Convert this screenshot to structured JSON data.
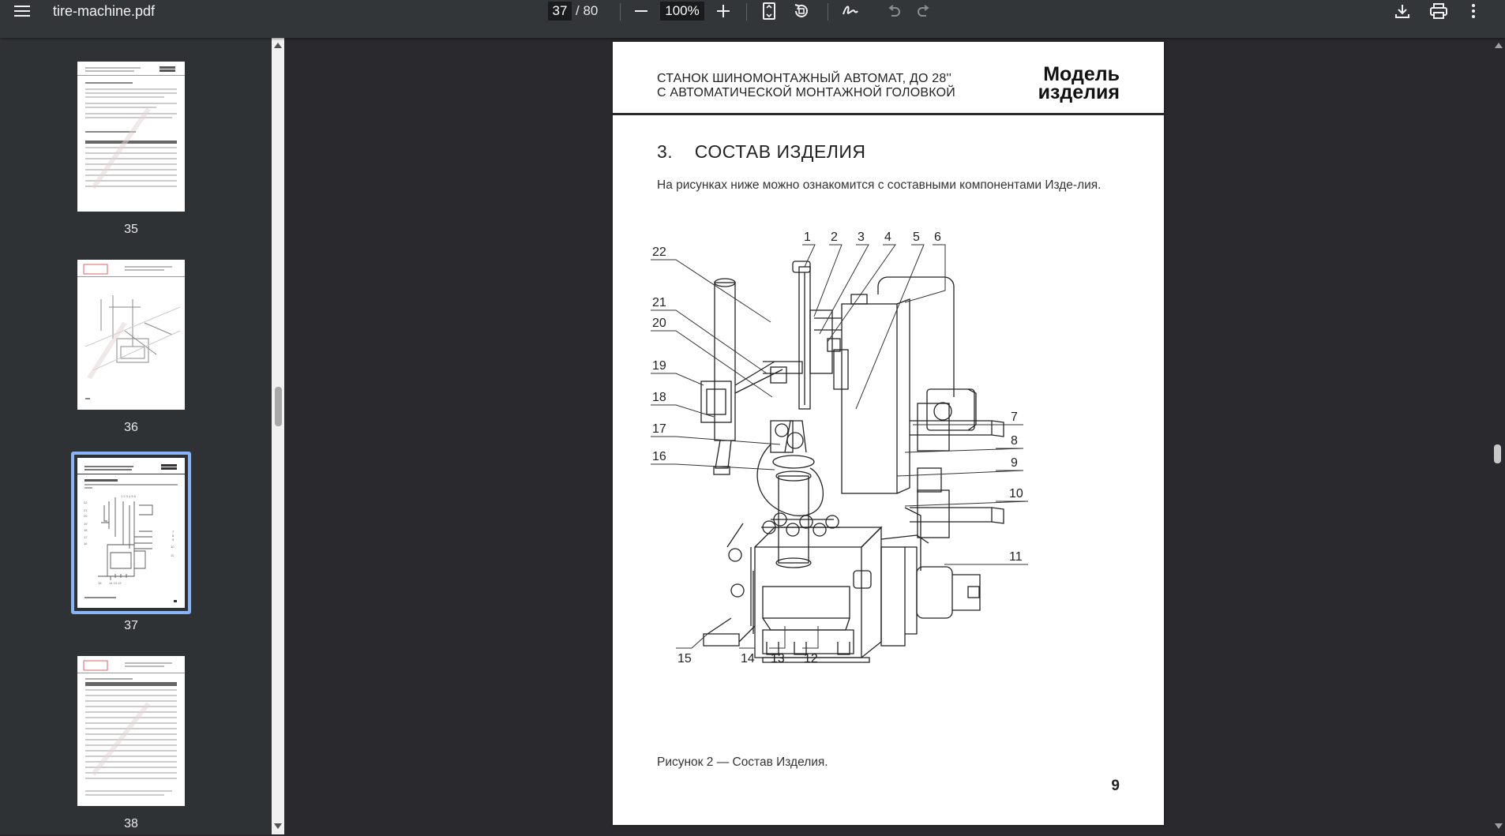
{
  "toolbar": {
    "file_name": "tire-machine.pdf",
    "current_page": "37",
    "total_pages": "/ 80",
    "zoom": "100%"
  },
  "sidebar": {
    "thumbnails": [
      {
        "label": "35"
      },
      {
        "label": "36"
      },
      {
        "label": "37",
        "selected": true
      },
      {
        "label": "38"
      }
    ]
  },
  "page": {
    "header_line1": "СТАНОК ШИНОМОНТАЖНЫЙ АВТОМАТ, ДО 28''",
    "header_line2": "С АВТОМАТИЧЕСКОЙ МОНТАЖНОЙ ГОЛОВКОЙ",
    "model_line1": "Модель",
    "model_line2": "изделия",
    "section_title": "3.    СОСТАВ ИЗДЕЛИЯ",
    "intro": "На рисунках ниже можно ознакомится с составными компонентами Изде-лия.",
    "callouts": [
      "1",
      "2",
      "3",
      "4",
      "5",
      "6",
      "7",
      "8",
      "9",
      "10",
      "11",
      "12",
      "13",
      "14",
      "15",
      "16",
      "17",
      "18",
      "19",
      "20",
      "21",
      "22"
    ],
    "caption": "Рисунок 2 — Состав Изделия.",
    "page_number": "9"
  },
  "colors": {
    "toolbar_bg": "#323639",
    "sidebar_bg": "#2f3235",
    "viewer_bg": "#2a2a2e",
    "selection": "#8ab4f8"
  }
}
